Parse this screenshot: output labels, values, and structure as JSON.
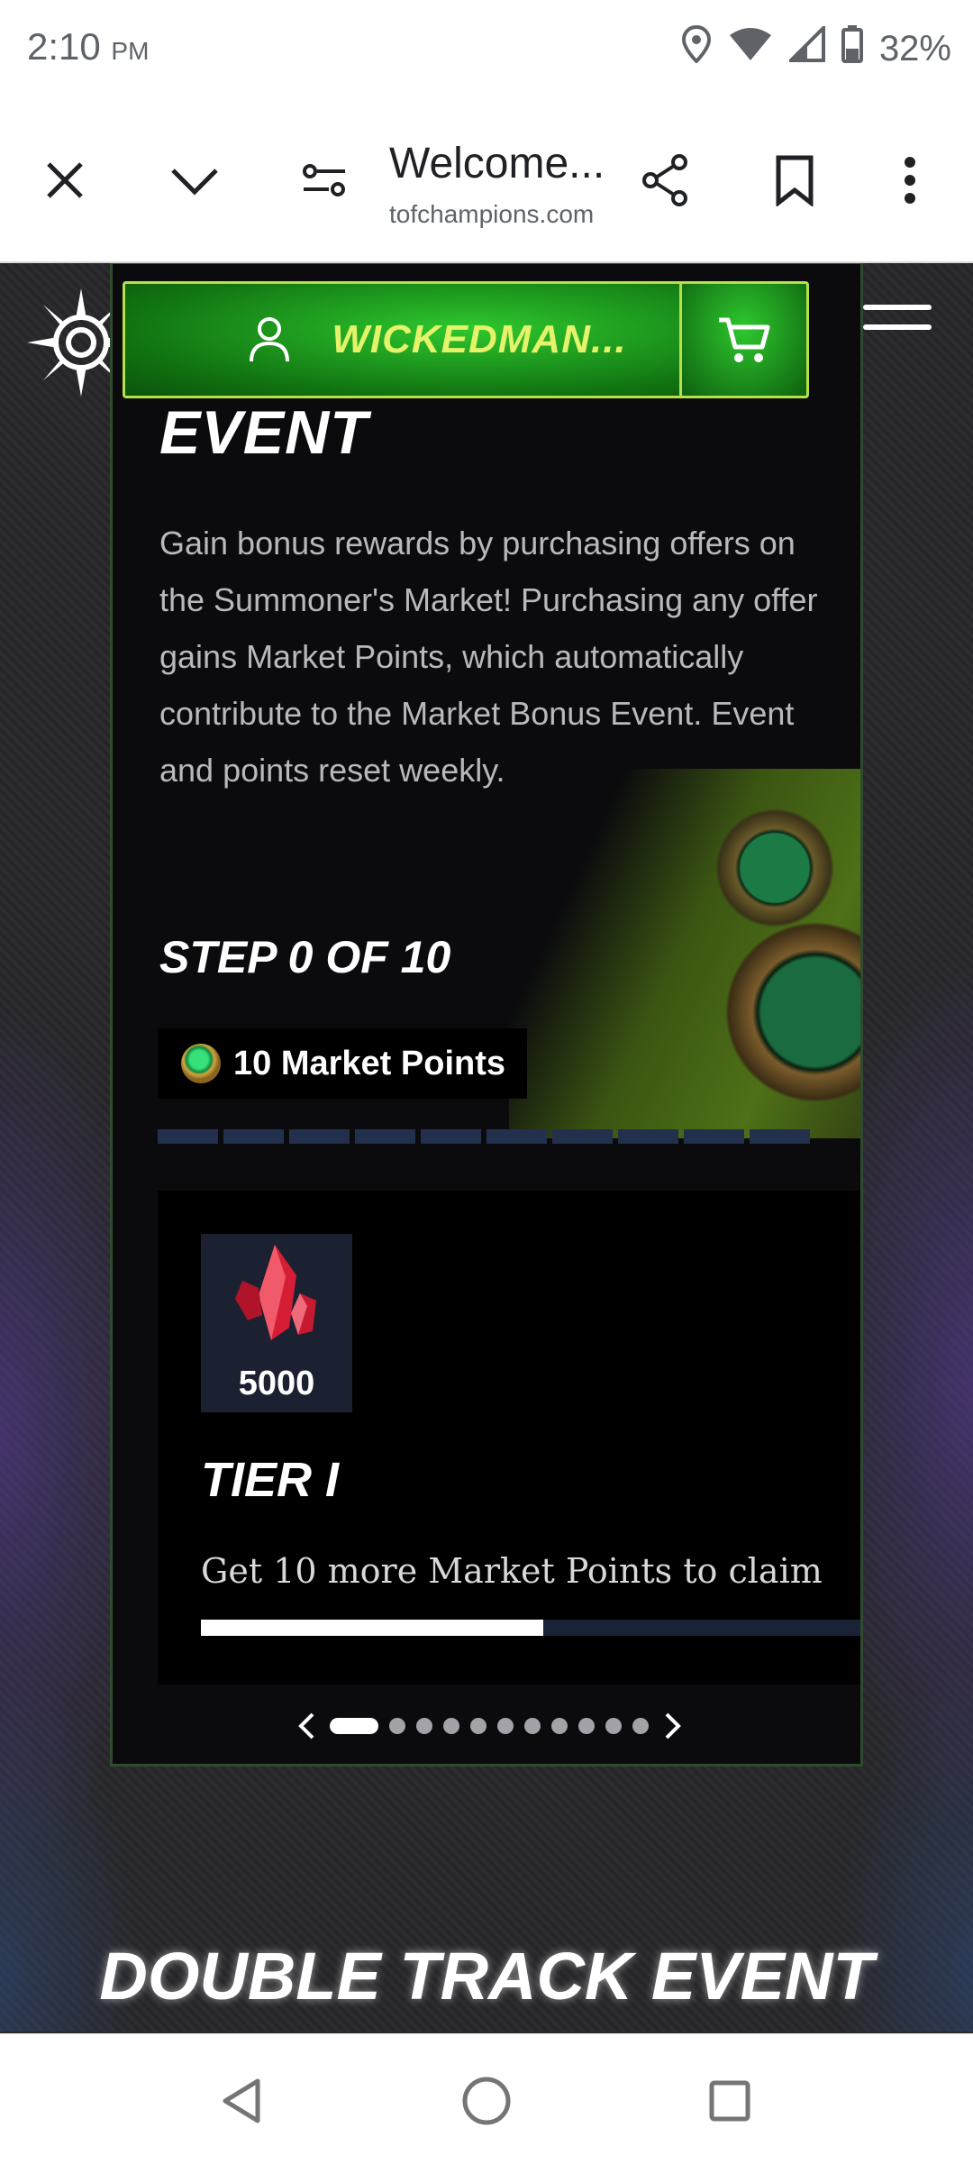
{
  "status_bar": {
    "time": "2:10",
    "ampm": "PM",
    "battery": "32%",
    "icons": [
      "location-icon",
      "wifi-icon",
      "signal-icon",
      "battery-icon"
    ]
  },
  "browser": {
    "page_title": "Welcome...",
    "domain": "tofchampions.com",
    "icons": [
      "close-icon",
      "chevron-down-icon",
      "page-info-icon",
      "share-icon",
      "bookmark-icon",
      "more-vert-icon"
    ]
  },
  "site_header": {
    "username": "WICKEDMAN...",
    "bg_logo_fragment": "S",
    "icons": [
      "spiked-emblem-icon",
      "user-icon",
      "cart-icon",
      "hamburger-menu-icon"
    ],
    "accent": "#b8e04a"
  },
  "event_card": {
    "title": "EVENT",
    "description": "Gain bonus rewards by purchasing offers on the Summoner's Market! Purchasing any offer gains Market Points, which automatically contribute to the Market Bonus Event. Event and points reset weekly.",
    "step_text": "STEP 0 OF 10",
    "points_label": "10 Market Points",
    "segments_total": 10,
    "tier": {
      "reward_amount": "5000",
      "reward_icon": "red-crystal-icon",
      "title": "TIER I",
      "claim_text": "Get 10 more Market Points to claim",
      "progress": 0.5
    },
    "pager": {
      "pages": 11,
      "active": 0
    }
  },
  "next_section": {
    "title": "DOUBLE TRACK EVENT"
  },
  "nav_bar": {
    "icons": [
      "back-icon",
      "home-icon",
      "recents-icon"
    ]
  }
}
